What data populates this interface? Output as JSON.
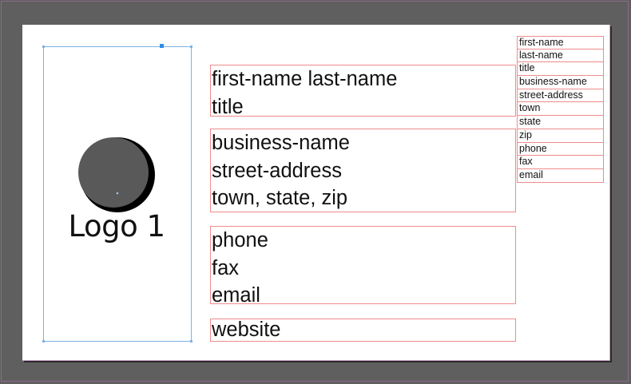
{
  "main_frames": {
    "name_block": [
      "first-name last-name",
      "title"
    ],
    "business_block": [
      "business-name",
      "street-address",
      "town, state, zip"
    ],
    "contact_block": [
      "phone",
      "fax",
      "email"
    ],
    "website_block": [
      "website"
    ]
  },
  "logo": {
    "text": "Logo 1",
    "circle_color": "#595959",
    "crescent_color": "#000000"
  },
  "field_list": [
    "first-name",
    "last-name",
    "title",
    "business-name",
    "street-address",
    "town",
    "state",
    "zip",
    "phone",
    "fax",
    "email"
  ],
  "colors": {
    "pasteboard": "#5f5f5f",
    "frame_border": "#ef8c8c",
    "selection_border": "#7fb2e5",
    "selection_handle": "#2f8ae6"
  }
}
